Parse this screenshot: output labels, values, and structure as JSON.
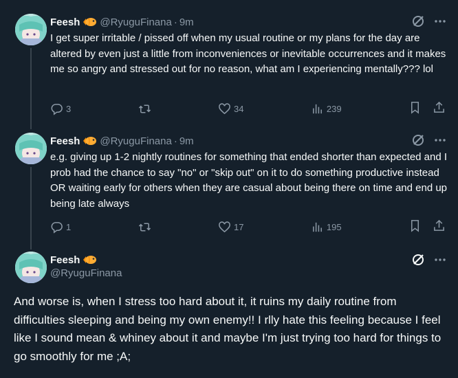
{
  "tweets": [
    {
      "name": "Feesh",
      "handle": "@RyuguFinana",
      "dot": "·",
      "time": "9m",
      "text": "I get super irritable / pissed off when my usual routine or my plans for the day are altered by even just a little from inconveniences or inevitable occurrences and it makes me so angry and stressed out for no reason, what am I experiencing mentally??? lol",
      "replies": "3",
      "likes": "34",
      "views": "239"
    },
    {
      "name": "Feesh",
      "handle": "@RyuguFinana",
      "dot": "·",
      "time": "9m",
      "text": "e.g. giving up 1-2 nightly routines for something that ended shorter than expected and I prob had the chance to say \"no\" or \"skip out\" on it to do something productive instead OR waiting early for others when they are casual about being there on time and end up being late always",
      "replies": "1",
      "likes": "17",
      "views": "195"
    }
  ],
  "main": {
    "name": "Feesh",
    "handle": "@RyuguFinana",
    "text": "And worse is, when I stress too hard about it, it ruins my daily routine from difficulties sleeping and being my own enemy!! I rlly hate this feeling because I feel like I sound mean & whiney about it and maybe I'm just trying too hard for things to go smoothly for me ;A;"
  },
  "colors": {
    "background": "#15202b",
    "text": "#f7f9f9",
    "secondary": "#8b98a5",
    "thread_line": "#38444d"
  },
  "icons": [
    "avatar",
    "fish-emoji-icon",
    "grok-icon",
    "more-icon",
    "reply-icon",
    "retweet-icon",
    "like-icon",
    "views-icon",
    "bookmark-icon",
    "share-icon"
  ]
}
